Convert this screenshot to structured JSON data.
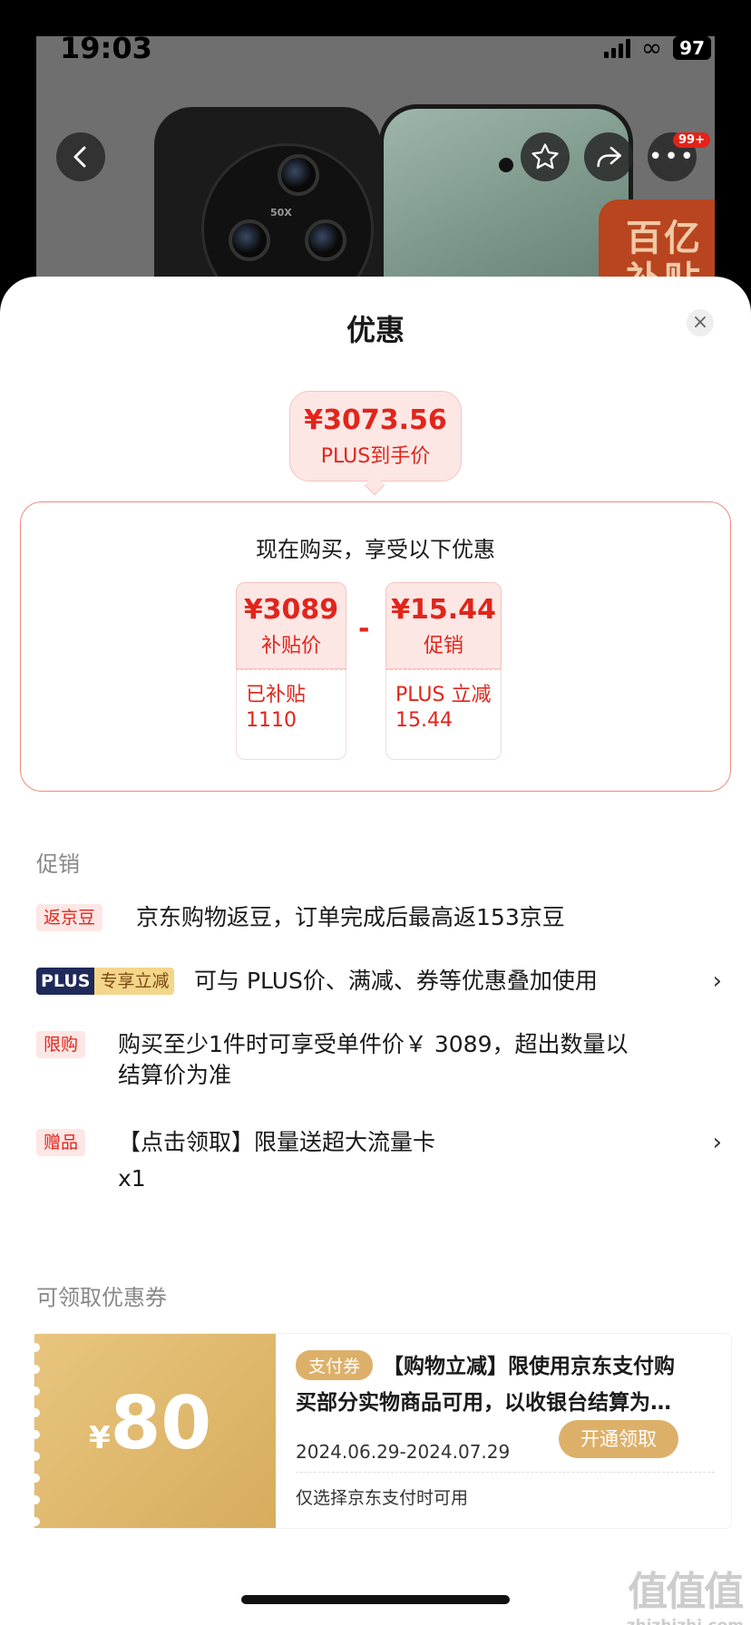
{
  "status": {
    "time": "19:03",
    "battery": "97"
  },
  "backdrop": {
    "lens_label": "50X",
    "badge": "百亿\n补贴",
    "more_badge": "99+"
  },
  "sheet": {
    "title": "优惠",
    "final_price": "¥3073.56",
    "final_label": "PLUS到手价",
    "calc_heading": "现在购买，享受以下优惠",
    "calc": [
      {
        "value": "¥3089",
        "label": "补贴价",
        "detail_line1": "已补贴",
        "detail_line2": "1110"
      },
      {
        "value": "¥15.44",
        "label": "促销",
        "detail_line1": "PLUS 立减",
        "detail_line2": "15.44"
      }
    ],
    "operator": "-"
  },
  "promotions": {
    "title": "促销",
    "items": [
      {
        "tag": "返京豆",
        "text": "京东购物返豆，订单完成后最高返153京豆"
      },
      {
        "tag_a": "PLUS",
        "tag_b": "专享立减",
        "text": "可与 PLUS价、满减、券等优惠叠加使用"
      },
      {
        "tag": "限购",
        "text_line1": "购买至少1件时可享受单件价￥ 3089，超出数量以",
        "text_line2": "结算价为准"
      },
      {
        "tag": "赠品",
        "text_line1": "【点击领取】限量送超大流量卡",
        "text_line2": "x1"
      }
    ]
  },
  "coupons": {
    "title": "可领取优惠券",
    "currency": "¥",
    "amount": "80",
    "type": "支付券",
    "desc": "【购物立减】限使用京东支付购买部分实物商品可用，以收银台结算为…",
    "date": "2024.06.29-2024.07.29",
    "button": "开通领取",
    "note": "仅选择京东支付时可用"
  },
  "watermark": {
    "big": "值值值",
    "small": "zhizhizhi.com"
  }
}
